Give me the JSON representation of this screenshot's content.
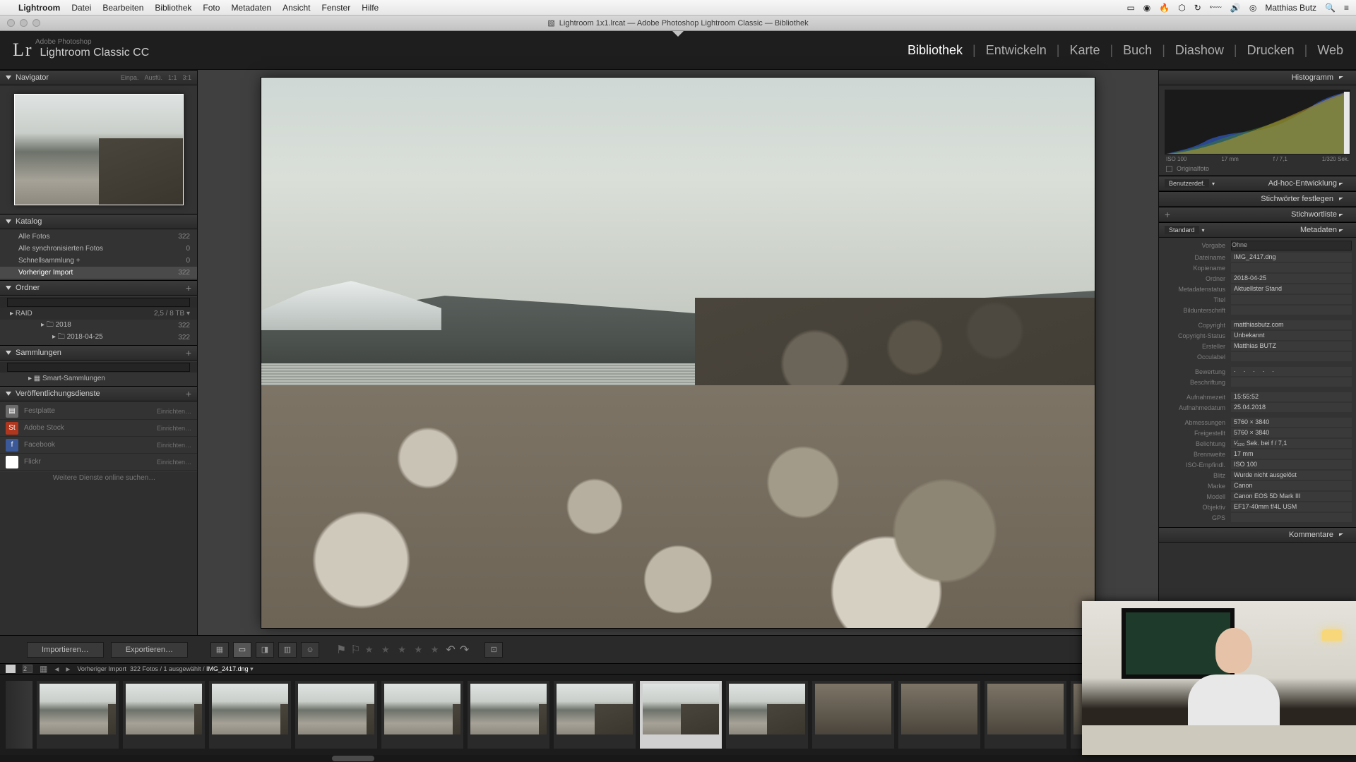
{
  "menubar": {
    "app": "Lightroom",
    "items": [
      "Datei",
      "Bearbeiten",
      "Bibliothek",
      "Foto",
      "Metadaten",
      "Ansicht",
      "Fenster",
      "Hilfe"
    ],
    "user": "Matthias Butz"
  },
  "window": {
    "title": "Lightroom 1x1.lrcat — Adobe Photoshop Lightroom Classic — Bibliothek"
  },
  "identity": {
    "subtitle": "Adobe Photoshop",
    "product": "Lightroom Classic CC",
    "logo": "Lr"
  },
  "modules": {
    "items": [
      "Bibliothek",
      "Entwickeln",
      "Karte",
      "Buch",
      "Diashow",
      "Drucken",
      "Web"
    ],
    "active": "Bibliothek"
  },
  "navigator": {
    "title": "Navigator",
    "opts": [
      "Einpa.",
      "Ausfü.",
      "1:1",
      "3:1"
    ]
  },
  "katalog": {
    "title": "Katalog",
    "items": [
      {
        "label": "Alle Fotos",
        "count": "322"
      },
      {
        "label": "Alle synchronisierten Fotos",
        "count": "0"
      },
      {
        "label": "Schnellsammlung  +",
        "count": "0"
      },
      {
        "label": "Vorheriger Import",
        "count": "322"
      }
    ]
  },
  "ordner": {
    "title": "Ordner",
    "volume": {
      "name": "RAID",
      "free": "2,5 / 8 TB"
    },
    "tree": [
      {
        "label": "2018",
        "count": "322",
        "indent": 2
      },
      {
        "label": "2018-04-25",
        "count": "322",
        "indent": 3
      }
    ]
  },
  "sammlungen": {
    "title": "Sammlungen",
    "smart": "Smart-Sammlungen"
  },
  "publish": {
    "title": "Veröffentlichungsdienste",
    "setup": "Einrichten…",
    "services": [
      {
        "name": "Festplatte",
        "color": "#6b6b6b",
        "glyph": "▤"
      },
      {
        "name": "Adobe Stock",
        "color": "#b1361e",
        "glyph": "St"
      },
      {
        "name": "Facebook",
        "color": "#3b5998",
        "glyph": "f"
      },
      {
        "name": "Flickr",
        "color": "#ffffff",
        "glyph": "••"
      }
    ],
    "more": "Weitere Dienste online suchen…"
  },
  "toolbar": {
    "import": "Importieren…",
    "export": "Exportieren…"
  },
  "grip": {
    "source": "Vorheriger Import",
    "counts": "322 Fotos / 1 ausgewählt /",
    "file": "IMG_2417.dng"
  },
  "histogram": {
    "title": "Histogramm",
    "iso": "ISO 100",
    "focal": "17 mm",
    "aperture": "f / 7,1",
    "shutter": "1/320 Sek."
  },
  "originalfoto": "Originalfoto",
  "rpanels": {
    "quickdev": "Ad-hoc-Entwicklung",
    "keywording": "Stichwörter festlegen",
    "keywordlist": "Stichwortliste",
    "metadata": "Metadaten",
    "comments": "Kommentare",
    "userdef": "Benutzerdef.",
    "standard": "Standard"
  },
  "metadata": {
    "preset_lbl": "Vorgabe",
    "preset": "Ohne",
    "rows": [
      {
        "lbl": "Dateiname",
        "val": "IMG_2417.dng"
      },
      {
        "lbl": "Kopiename",
        "val": ""
      },
      {
        "lbl": "Ordner",
        "val": "2018-04-25"
      },
      {
        "lbl": "Metadatenstatus",
        "val": "Aktuellster Stand"
      },
      {
        "lbl": "Titel",
        "val": ""
      },
      {
        "lbl": "Bildunterschrift",
        "val": ""
      }
    ],
    "rows2": [
      {
        "lbl": "Copyright",
        "val": "matthiasbutz.com"
      },
      {
        "lbl": "Copyright-Status",
        "val": "Unbekannt"
      },
      {
        "lbl": "Ersteller",
        "val": "Matthias BUTZ"
      },
      {
        "lbl": "Occulabel",
        "val": ""
      }
    ],
    "rating_lbl": "Bewertung",
    "rows3": [
      {
        "lbl": "Beschriftung",
        "val": ""
      }
    ],
    "rows4": [
      {
        "lbl": "Aufnahmezeit",
        "val": "15:55:52"
      },
      {
        "lbl": "Aufnahmedatum",
        "val": "25.04.2018"
      }
    ],
    "rows5": [
      {
        "lbl": "Abmessungen",
        "val": "5760 × 3840"
      },
      {
        "lbl": "Freigestellt",
        "val": "5760 × 3840"
      },
      {
        "lbl": "Belichtung",
        "val": "¹⁄₃₂₀ Sek. bei f / 7,1"
      },
      {
        "lbl": "Brennweite",
        "val": "17 mm"
      },
      {
        "lbl": "ISO-Empfindl.",
        "val": "ISO 100"
      },
      {
        "lbl": "Blitz",
        "val": "Wurde nicht ausgelöst"
      },
      {
        "lbl": "Marke",
        "val": "Canon"
      },
      {
        "lbl": "Modell",
        "val": "Canon EOS 5D Mark III"
      },
      {
        "lbl": "Objektiv",
        "val": "EF17-40mm f/4L USM"
      },
      {
        "lbl": "GPS",
        "val": ""
      }
    ]
  },
  "filmstrip": {
    "thumbs": [
      {
        "variant": "light"
      },
      {
        "variant": "light"
      },
      {
        "variant": "light"
      },
      {
        "variant": "light"
      },
      {
        "variant": "light"
      },
      {
        "variant": "light"
      },
      {
        "variant": "mid"
      },
      {
        "variant": "mid",
        "sel": true
      },
      {
        "variant": "mid"
      },
      {
        "variant": "dark"
      },
      {
        "variant": "dark"
      },
      {
        "variant": "dark"
      },
      {
        "variant": "dark"
      }
    ]
  }
}
